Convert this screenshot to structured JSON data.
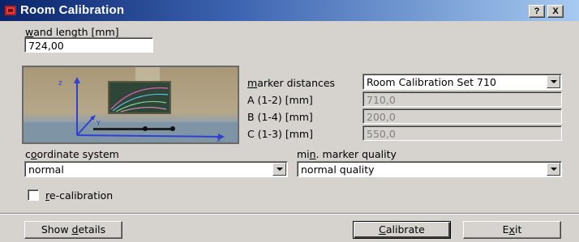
{
  "window": {
    "title": "Room Calibration",
    "help_button": "?",
    "close_button": "X"
  },
  "wand_length": {
    "label_mnemonic": "w",
    "label_rest": "and length [mm]",
    "value": "724,00"
  },
  "marker_distances": {
    "label_mnemonic": "m",
    "label_rest": "arker distances",
    "selected": "Room Calibration Set 710",
    "rows": [
      {
        "label": "A (1-2) [mm]",
        "value": "710,0"
      },
      {
        "label": "B (1-4) [mm]",
        "value": "200,0"
      },
      {
        "label": "C (1-3) [mm]",
        "value": "550,0"
      }
    ]
  },
  "coordinate_system": {
    "label_pre": "c",
    "label_mnemonic": "o",
    "label_rest": "ordinate system",
    "selected": "normal"
  },
  "marker_quality": {
    "label_pre": "mi",
    "label_mnemonic": "n",
    "label_rest": ". marker quality",
    "selected": "normal quality"
  },
  "recalibration": {
    "label_mnemonic": "r",
    "label_rest": "e-calibration",
    "checked": false
  },
  "photo_axes": {
    "z": "z",
    "y": "Y",
    "x": "x"
  },
  "buttons": {
    "show_details_pre": "Show ",
    "show_details_mnemonic": "d",
    "show_details_rest": "etails",
    "calibrate_mnemonic": "C",
    "calibrate_rest": "alibrate",
    "exit_pre": "E",
    "exit_mnemonic": "x",
    "exit_rest": "it"
  }
}
